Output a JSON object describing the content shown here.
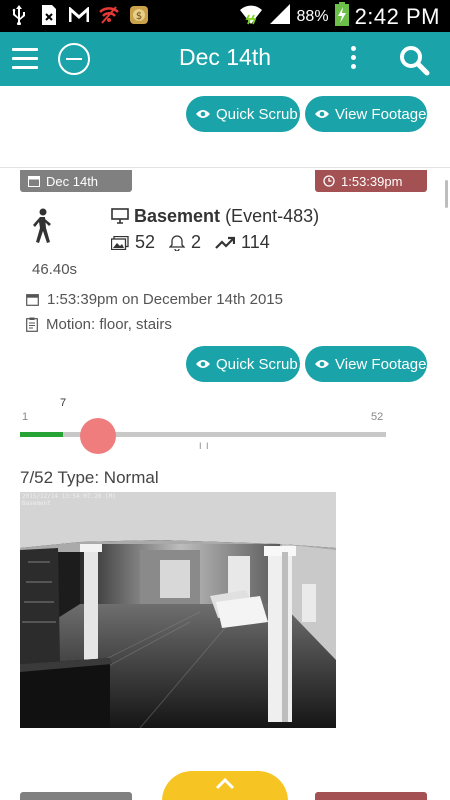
{
  "status_bar": {
    "battery_percent": "88%",
    "time": "2:42 PM",
    "left_icons": [
      "usb-icon",
      "sim-blocked-icon",
      "gmail-icon",
      "wifi-off-icon",
      "coin-app-icon"
    ],
    "right_icons": [
      "wifi-icon",
      "signal-icon",
      "battery-charging-icon"
    ]
  },
  "app_bar": {
    "title": "Dec 14th",
    "color": "#1aa3a8",
    "icons": [
      "menu-icon",
      "remove-circle-icon",
      "more-vert-icon",
      "search-icon"
    ]
  },
  "top_actions": {
    "quick_scrub_label": "Quick Scrub",
    "view_footage_label": "View Footage"
  },
  "event": {
    "date_tag": "Dec 14th",
    "time_tag": "1:53:39pm",
    "activity_icon": "person-walking-icon",
    "duration": "46.40s",
    "monitor_name": "Basement",
    "event_id": "(Event-483)",
    "frames": "52",
    "alarms": "2",
    "score": "114",
    "datetime": "1:53:39pm on December 14th 2015",
    "cause": "Motion: floor, stairs",
    "quick_scrub_label": "Quick Scrub",
    "view_footage_label": "View Footage"
  },
  "scrubber": {
    "current": "7",
    "min": "1",
    "max": "52",
    "tick_marks": "I I",
    "fill_color": "#27a335",
    "handle_color": "#f07d7d"
  },
  "frame": {
    "label": "7/52 Type: Normal",
    "timestamp_overlay_line1": "2015/12/14 13:54:07.20 (M)",
    "timestamp_overlay_line2": "Basement"
  },
  "fab": {
    "icon": "chevron-up-icon",
    "color": "#f6c523"
  }
}
